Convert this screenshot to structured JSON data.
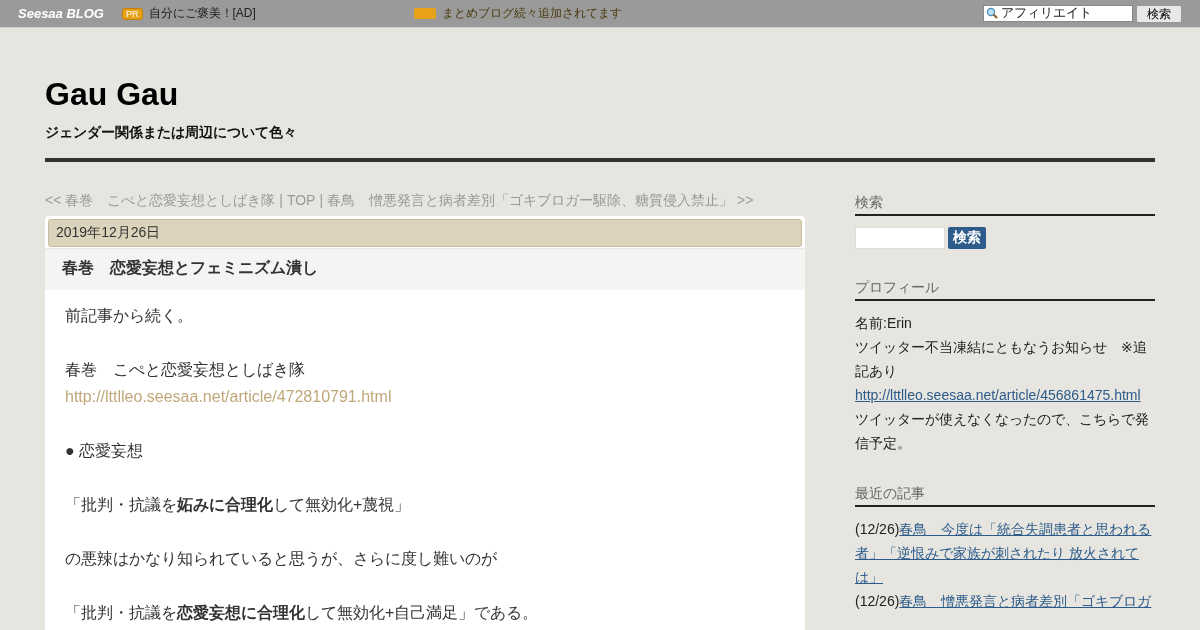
{
  "topbar": {
    "logo": "Seesaa BLOG",
    "pr_badge": "PR",
    "ad_text": "自分にご褒美！[AD]",
    "notice": "まとめブログ続々追加されてます",
    "search_value": "アフィリエイト",
    "search_button": "検索"
  },
  "blog": {
    "title": "Gau Gau",
    "subtitle": "ジェンダー関係または周辺について色々"
  },
  "nav": [
    {
      "kind": "link",
      "text": "<< 春巻　こぺと恋愛妄想としばき隊"
    },
    {
      "kind": "sep",
      "text": "|"
    },
    {
      "kind": "link",
      "text": "TOP"
    },
    {
      "kind": "sep",
      "text": "|"
    },
    {
      "kind": "link",
      "text": "春鳥　憎悪発言と病者差別「ゴキブロガー駆除、糖質侵入禁止」 >>"
    }
  ],
  "article": {
    "date": "2019年12月26日",
    "title": "春巻　恋愛妄想とフェミニズム潰し",
    "paragraphs": [
      [
        {
          "kind": "text",
          "text": "前記事から続く。"
        }
      ],
      [
        {
          "kind": "text",
          "text": "春巻　こぺと恋愛妄想としばき隊"
        },
        {
          "kind": "link",
          "text": "http://lttlleo.seesaa.net/article/472810791.html"
        }
      ],
      [
        {
          "kind": "text",
          "text": "● 恋愛妄想"
        }
      ],
      [
        {
          "kind": "text",
          "text": "「批判・抗議を**妬みに合理化**して無効化+蔑視」"
        }
      ],
      [
        {
          "kind": "text",
          "text": "の悪辣はかなり知られていると思うが、さらに度し難いのが"
        }
      ],
      [
        {
          "kind": "text",
          "text": "「批判・抗議を**恋愛妄想に合理化**して無効化+自己満足」である。"
        }
      ]
    ]
  },
  "sidebar": [
    {
      "kind": "search",
      "heading": "検索",
      "button": "検索"
    },
    {
      "kind": "profile",
      "heading": "プロフィール",
      "lines": [
        {
          "kind": "text",
          "text": "名前:Erin"
        },
        {
          "kind": "text",
          "text": "ツイッター不当凍結にともなうお知らせ　※追記あり"
        },
        {
          "kind": "link",
          "text": "http://lttlleo.seesaa.net/article/456861475.html"
        },
        {
          "kind": "text",
          "text": "ツイッターが使えなくなったので、こちらで発信予定。"
        }
      ]
    },
    {
      "kind": "recent",
      "heading": "最近の記事",
      "items": [
        {
          "date": "(12/26)",
          "title": "春鳥　今度は「統合失調患者と思われる者」「逆恨みで家族が刺されたり 放火されては」"
        },
        {
          "date": "(12/26)",
          "title": "春鳥　憎悪発言と病者差別「ゴキブロガ"
        }
      ]
    }
  ]
}
